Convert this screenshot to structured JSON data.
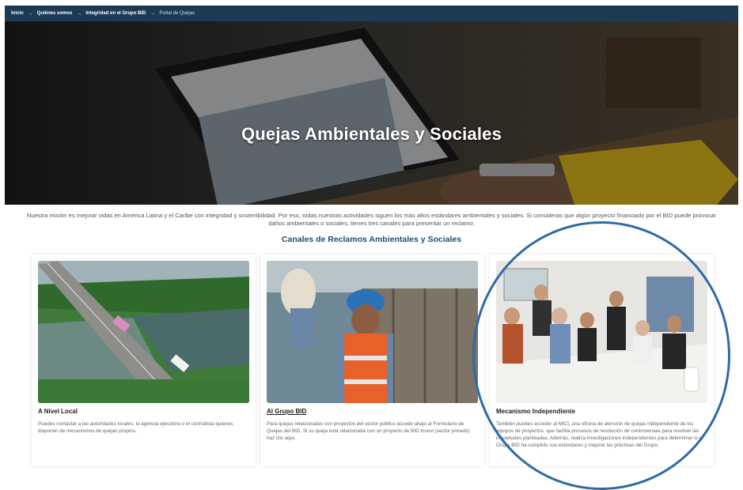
{
  "breadcrumb": [
    {
      "label": "Inicio",
      "current": false
    },
    {
      "label": "Quiénes somos",
      "current": false
    },
    {
      "label": "Integridad en el Grupo BID",
      "current": false
    },
    {
      "label": "Portal de Quejas",
      "current": true
    }
  ],
  "hero": {
    "title": "Quejas Ambientales y Sociales"
  },
  "intro": {
    "text": "Nuestra misión es mejorar vidas en América Latina y el Caribe con integridad y sostenibilidad. Por eso, todas nuestras actividades siguen los más altos estándares ambientales y sociales. Si consideras que algún proyecto financiado por el BID puede provocar daños ambientales o sociales, tienes tres canales para presentar un reclamo:"
  },
  "section": {
    "title": "Canales de Reclamos Ambientales y Sociales"
  },
  "cards": [
    {
      "title": "A Nivel Local",
      "body": "Puedes contactar a las autoridades locales, la agencia ejecutora o el contratista quienes disponen de mecanismos de quejas propios."
    },
    {
      "title": "Al Grupo BID",
      "body": "Para quejas relacionadas con proyectos del sector público accede abajo al Formulario de Quejas del BID. Si su queja está relacionada con un proyecto de BID Invest (sector privado) haz clic aquí."
    },
    {
      "title": "Mecanismo Independiente",
      "body": "También puedes acceder al MICI, una oficina de atención de quejas independiente de los equipos de proyectos, que facilita procesos de resolución de controversias para resolver las inquietudes planteadas. Además, realiza investigaciones independientes para determinar si el Grupo BID ha cumplido sus estándares y mejorar las prácticas del Grupo."
    }
  ],
  "colors": {
    "breadcrumb_bg": "#1d3a55",
    "section_title": "#1d4e7a",
    "highlight_circle": "#2e6aa7"
  }
}
